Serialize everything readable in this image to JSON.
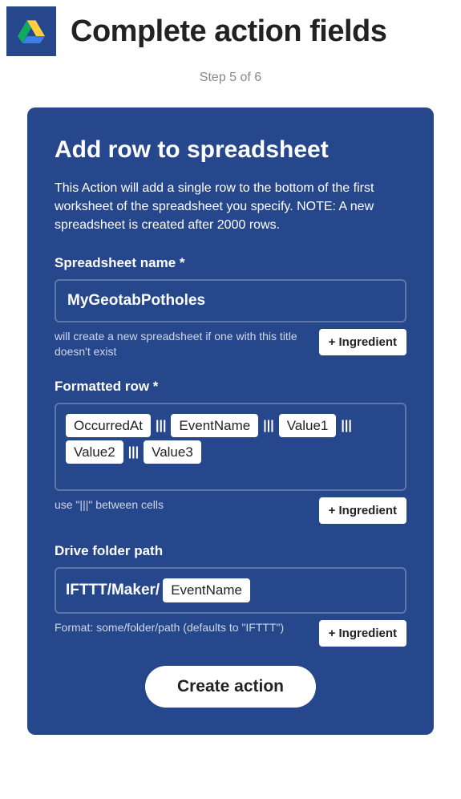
{
  "header": {
    "title": "Complete action fields",
    "step": "Step 5 of 6"
  },
  "card": {
    "title": "Add row to spreadsheet",
    "description": "This Action will add a single row to the bottom of the first worksheet of the spreadsheet you specify. NOTE: A new spreadsheet is created after 2000 rows."
  },
  "fields": {
    "spreadsheet": {
      "label": "Spreadsheet name *",
      "value": "MyGeotabPotholes",
      "hint": "will create a new spreadsheet if one with this title doesn't exist",
      "ingredient_btn": "+ Ingredient"
    },
    "row": {
      "label": "Formatted row *",
      "chips": [
        "OccurredAt",
        "EventName",
        "Value1",
        "Value2",
        "Value3"
      ],
      "separator": "|||",
      "hint": "use \"|||\" between cells",
      "ingredient_btn": "+ Ingredient"
    },
    "path": {
      "label": "Drive folder path",
      "prefix": "IFTTT/Maker/",
      "chip": "EventName",
      "hint": "Format: some/folder/path (defaults to \"IFTTT\")",
      "ingredient_btn": "+ Ingredient"
    }
  },
  "actions": {
    "create": "Create action"
  }
}
